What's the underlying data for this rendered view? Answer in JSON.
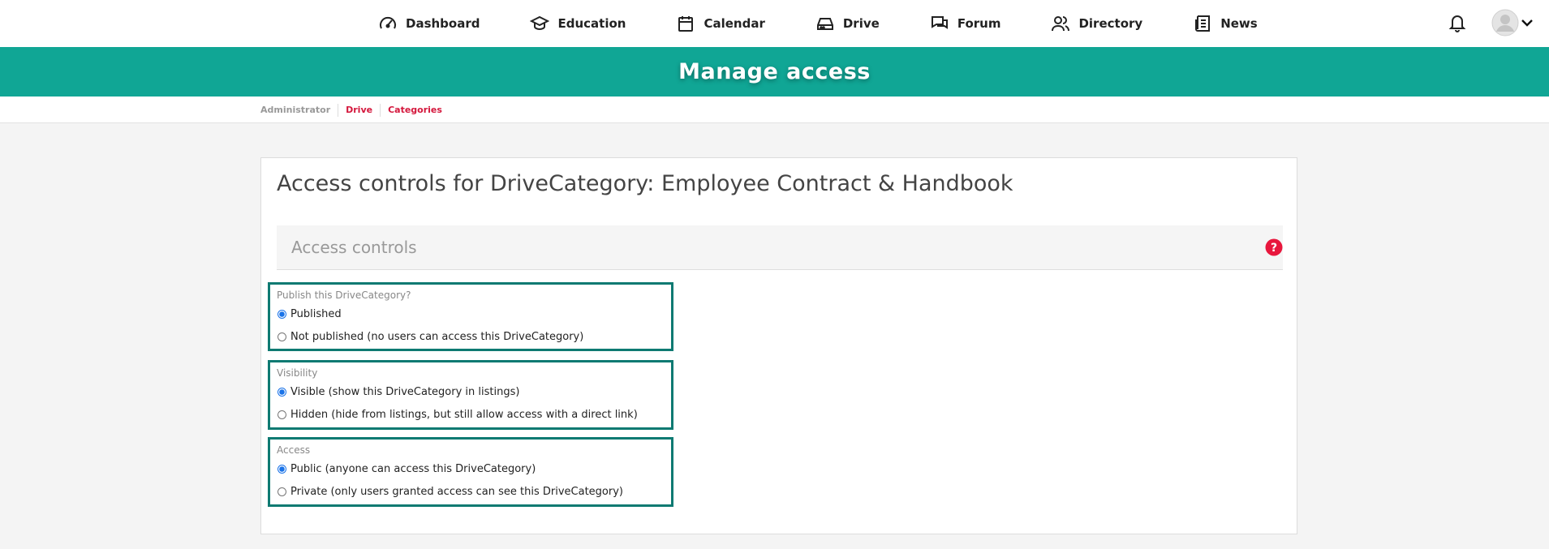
{
  "nav": {
    "items": [
      {
        "label": "Dashboard",
        "icon": "gauge-icon"
      },
      {
        "label": "Education",
        "icon": "graduation-cap-icon"
      },
      {
        "label": "Calendar",
        "icon": "calendar-icon"
      },
      {
        "label": "Drive",
        "icon": "drive-icon"
      },
      {
        "label": "Forum",
        "icon": "chat-icon"
      },
      {
        "label": "Directory",
        "icon": "people-icon"
      },
      {
        "label": "News",
        "icon": "news-icon"
      }
    ]
  },
  "banner": {
    "title": "Manage access"
  },
  "breadcrumb": {
    "items": [
      "Administrator",
      "Drive",
      "Categories"
    ]
  },
  "card": {
    "title": "Access controls for DriveCategory: Employee Contract & Handbook",
    "section_label": "Access controls"
  },
  "groups": {
    "publish": {
      "label": "Publish this DriveCategory?",
      "options": [
        "Published",
        "Not published (no users can access this DriveCategory)"
      ],
      "selected": 0
    },
    "visibility": {
      "label": "Visibility",
      "options": [
        "Visible (show this DriveCategory in listings)",
        "Hidden (hide from listings, but still allow access with a direct link)"
      ],
      "selected": 0
    },
    "access": {
      "label": "Access",
      "options": [
        "Public (anyone can access this DriveCategory)",
        "Private (only users granted access can see this DriveCategory)"
      ],
      "selected": 0
    }
  },
  "colors": {
    "brand": "#10a695",
    "link": "#d4173c",
    "group_border": "#0e7a72"
  }
}
